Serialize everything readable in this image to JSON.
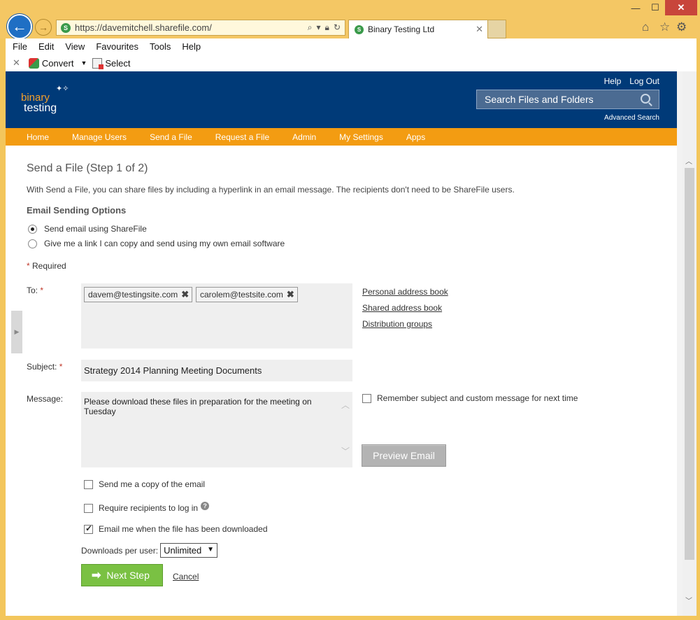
{
  "browser": {
    "url": "https://davemitchell.sharefile.com/",
    "url_host_highlight": "sharefile.com",
    "tab_title": "Binary Testing Ltd",
    "menu": [
      "File",
      "Edit",
      "View",
      "Favourites",
      "Tools",
      "Help"
    ],
    "cmd_convert": "Convert",
    "cmd_select": "Select"
  },
  "header": {
    "logo_line1": "binary",
    "logo_line2": "testing",
    "help": "Help",
    "logout": "Log Out",
    "search_placeholder": "Search Files and Folders",
    "advanced_search": "Advanced Search"
  },
  "nav": [
    "Home",
    "Manage Users",
    "Send a File",
    "Request a File",
    "Admin",
    "My Settings",
    "Apps"
  ],
  "page": {
    "title": "Send a File (Step 1 of 2)",
    "intro": "With Send a File, you can share files by including a hyperlink in an email message. The recipients don't need to be ShareFile users.",
    "options_heading": "Email Sending Options",
    "option_sharefile": "Send email using ShareFile",
    "option_link": "Give me a link I can copy and send using my own email software",
    "required_note": "Required",
    "to_label": "To:",
    "recipients": [
      "davem@testingsite.com",
      "carolem@testsite.com"
    ],
    "address_links": [
      "Personal address book",
      "Shared address book",
      "Distribution groups"
    ],
    "subject_label": "Subject:",
    "subject_value": "Strategy 2014 Planning Meeting Documents",
    "message_label": "Message:",
    "message_value": "Please download these files in preparation for the meeting on Tuesday",
    "remember_label": "Remember subject and custom message for next time",
    "preview_button": "Preview Email",
    "send_copy_label": "Send me a copy of the email",
    "require_login_label": "Require recipients to log in",
    "email_downloaded_label": "Email me when the file has been downloaded",
    "downloads_label": "Downloads per user:",
    "downloads_value": "Unlimited",
    "next_button": "Next Step",
    "cancel_link": "Cancel"
  },
  "colors": {
    "header_bg": "#003a78",
    "nav_bg": "#f39c12",
    "next_btn": "#7ac143"
  }
}
